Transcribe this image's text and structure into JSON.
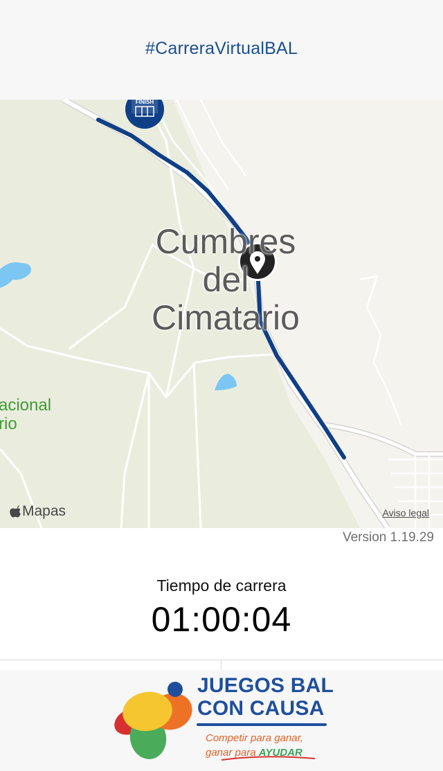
{
  "header": {
    "title": "#CarreraVirtualBAL"
  },
  "map": {
    "place_label_lines": [
      "Cumbres",
      "del",
      "Cimatario"
    ],
    "park_label_lines": [
      "acional",
      "rio"
    ],
    "finish_label": "FINISH",
    "brand": "Mapas",
    "legal_link": "Aviso legal",
    "colors": {
      "route": "#0f3f86",
      "park_label": "#3f9b35",
      "water": "#7bc6f2"
    }
  },
  "version": "Version 1.19.29",
  "race": {
    "time_label": "Tiempo de carrera",
    "time_value": "01:00:04"
  },
  "footer": {
    "logo_title_lines": [
      "JUEGOS BAL",
      "CON CAUSA"
    ],
    "slogan_line1": "Competir para ganar,",
    "slogan_line2_prefix": "ganar para ",
    "slogan_line2_accent": "AYUDAR"
  }
}
